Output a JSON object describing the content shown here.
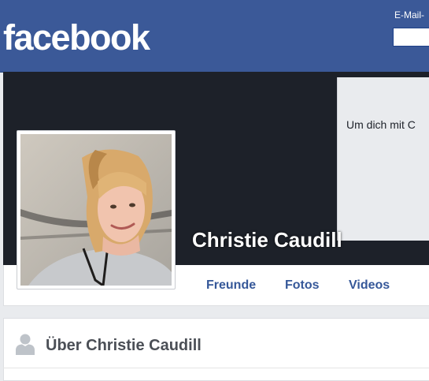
{
  "header": {
    "logo": "facebook",
    "email_label": "E-Mail-",
    "email_value": ""
  },
  "cover": {
    "box_text": "Um dich mit C"
  },
  "profile": {
    "name": "Christie Caudill",
    "tabs": [
      "Freunde",
      "Fotos",
      "Videos"
    ]
  },
  "about": {
    "title": "Über Christie Caudill"
  },
  "colors": {
    "brand": "#3b5998",
    "link": "#365899",
    "cover": "#1d2129",
    "background": "#e9ebee"
  },
  "icons": {
    "about": "person-icon"
  }
}
